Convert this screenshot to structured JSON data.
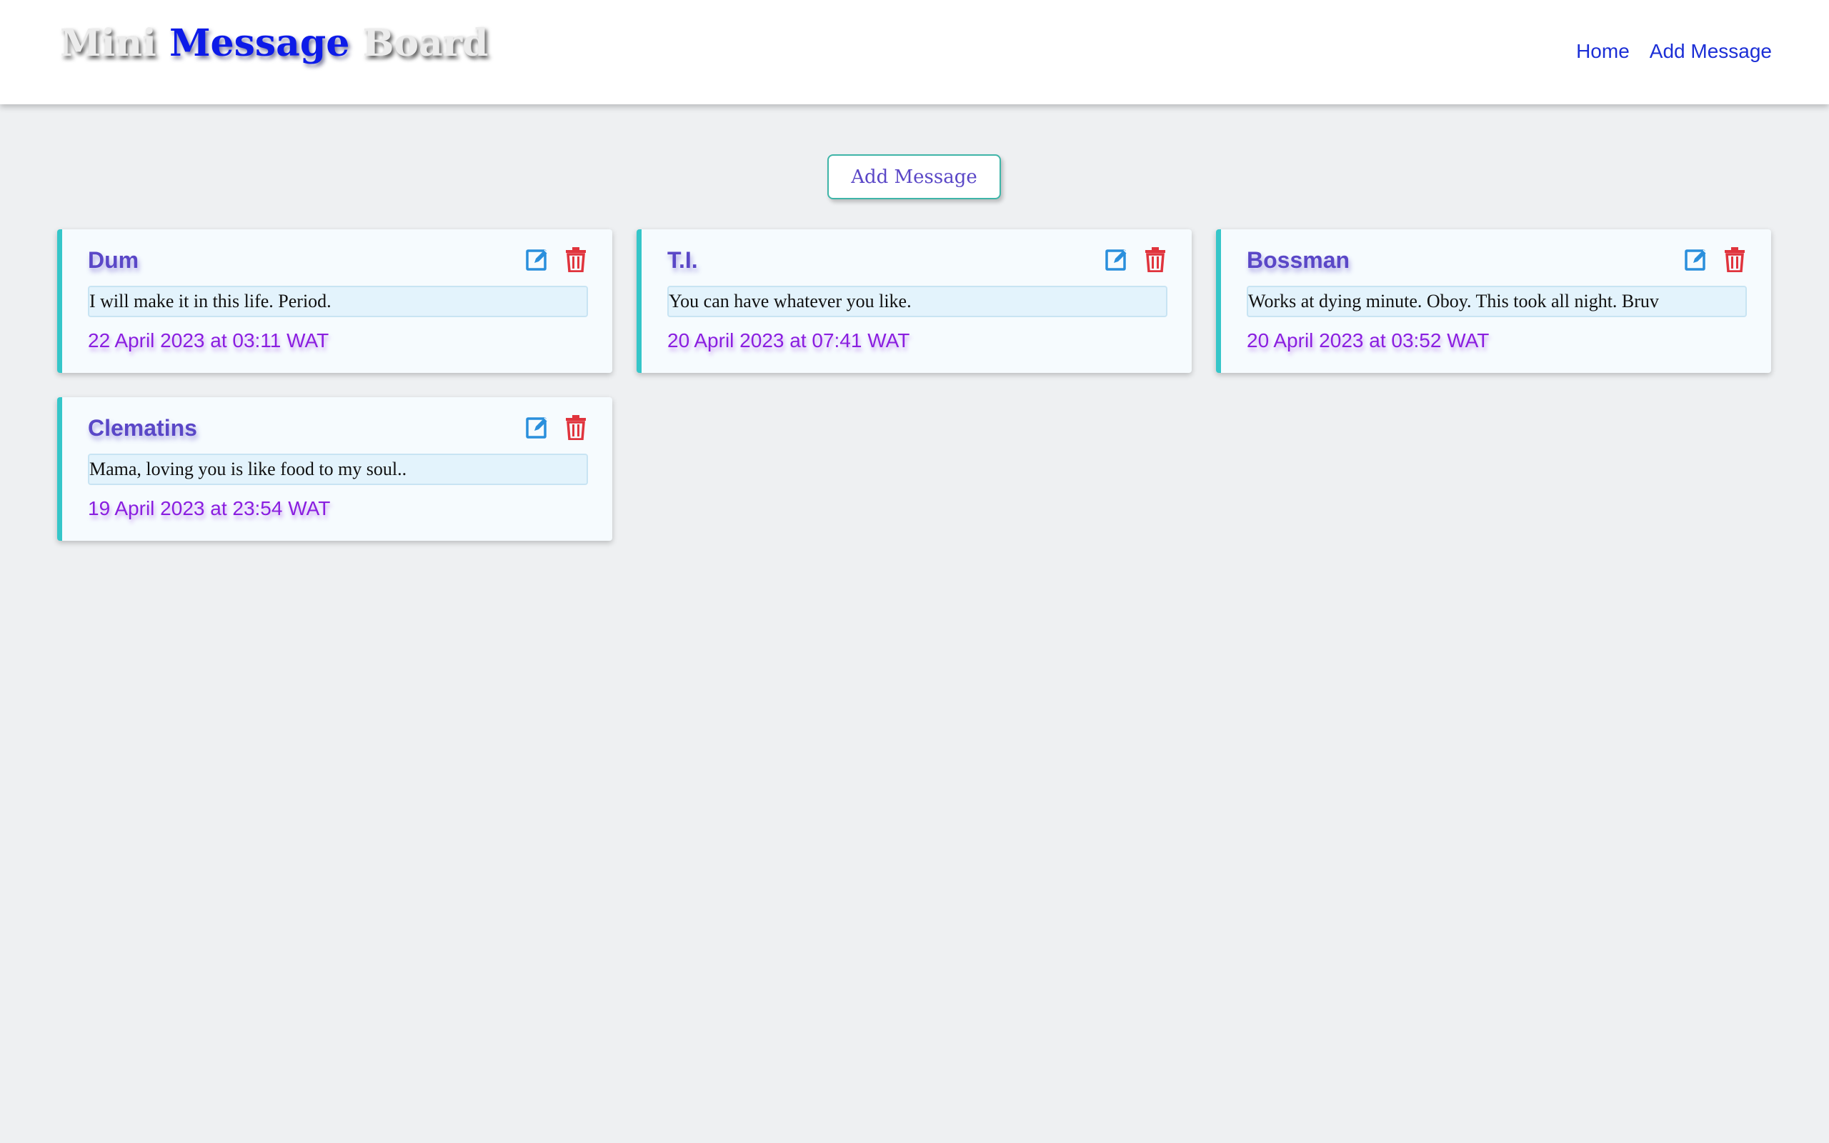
{
  "header": {
    "logo": {
      "part1": "Mini",
      "part2": "Message",
      "part3": "Board"
    },
    "nav": [
      {
        "label": "Home"
      },
      {
        "label": "Add Message"
      }
    ]
  },
  "main": {
    "add_button_label": "Add Message",
    "messages": [
      {
        "author": "Dum",
        "text": "I will make it in this life. Period.",
        "date": "22 April 2023 at 03:11 WAT"
      },
      {
        "author": "T.I.",
        "text": "You can have whatever you like.",
        "date": "20 April 2023 at 07:41 WAT"
      },
      {
        "author": "Bossman",
        "text": "Works at dying minute. Oboy. This took all night. Bruv",
        "date": "20 April 2023 at 03:52 WAT"
      },
      {
        "author": "Clematins",
        "text": "Mama, loving you is like food to my soul..",
        "date": "19 April 2023 at 23:54 WAT"
      }
    ]
  },
  "colors": {
    "accent_border": "#35c6c9",
    "title": "#5a47c7",
    "date": "#8a1ee0",
    "edit_icon": "#2a8fdc",
    "delete_icon": "#e0343d",
    "nav_link": "#1c2fd6"
  },
  "icons": {
    "edit": "edit-icon",
    "delete": "trash-icon"
  }
}
